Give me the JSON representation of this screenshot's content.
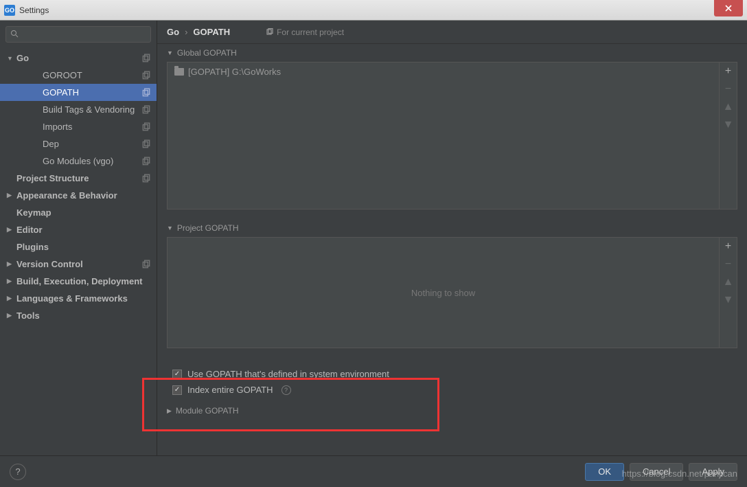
{
  "window": {
    "title": "Settings",
    "app_icon_text": "GO"
  },
  "search": {
    "placeholder": ""
  },
  "sidebar": {
    "items": [
      {
        "label": "Go",
        "kind": "top",
        "arrow": "down",
        "copy": true
      },
      {
        "label": "GOROOT",
        "kind": "child",
        "copy": true
      },
      {
        "label": "GOPATH",
        "kind": "child",
        "copy": true,
        "selected": true
      },
      {
        "label": "Build Tags & Vendoring",
        "kind": "child",
        "copy": true
      },
      {
        "label": "Imports",
        "kind": "child",
        "copy": true
      },
      {
        "label": "Dep",
        "kind": "child",
        "copy": true
      },
      {
        "label": "Go Modules (vgo)",
        "kind": "child",
        "copy": true
      },
      {
        "label": "Project Structure",
        "kind": "top",
        "arrow": "none",
        "copy": true
      },
      {
        "label": "Appearance & Behavior",
        "kind": "top",
        "arrow": "right"
      },
      {
        "label": "Keymap",
        "kind": "top",
        "arrow": "none"
      },
      {
        "label": "Editor",
        "kind": "top",
        "arrow": "right"
      },
      {
        "label": "Plugins",
        "kind": "top",
        "arrow": "none"
      },
      {
        "label": "Version Control",
        "kind": "top",
        "arrow": "right",
        "copy": true
      },
      {
        "label": "Build, Execution, Deployment",
        "kind": "top",
        "arrow": "right"
      },
      {
        "label": "Languages & Frameworks",
        "kind": "top",
        "arrow": "right"
      },
      {
        "label": "Tools",
        "kind": "top",
        "arrow": "right"
      }
    ]
  },
  "breadcrumb": {
    "a": "Go",
    "b": "GOPATH",
    "hint": "For current project"
  },
  "sections": {
    "global": {
      "title": "Global GOPATH",
      "entry": "[GOPATH] G:\\GoWorks"
    },
    "project": {
      "title": "Project GOPATH",
      "empty": "Nothing to show"
    },
    "module": {
      "title": "Module GOPATH"
    }
  },
  "checkboxes": {
    "use_system": {
      "label": "Use GOPATH that's defined in system environment",
      "checked": true
    },
    "index_entire": {
      "label": "Index entire GOPATH",
      "checked": true
    }
  },
  "footer": {
    "ok": "OK",
    "cancel": "Cancel",
    "apply": "Apply"
  },
  "watermark": "https://blog.csdn.net/panjican"
}
